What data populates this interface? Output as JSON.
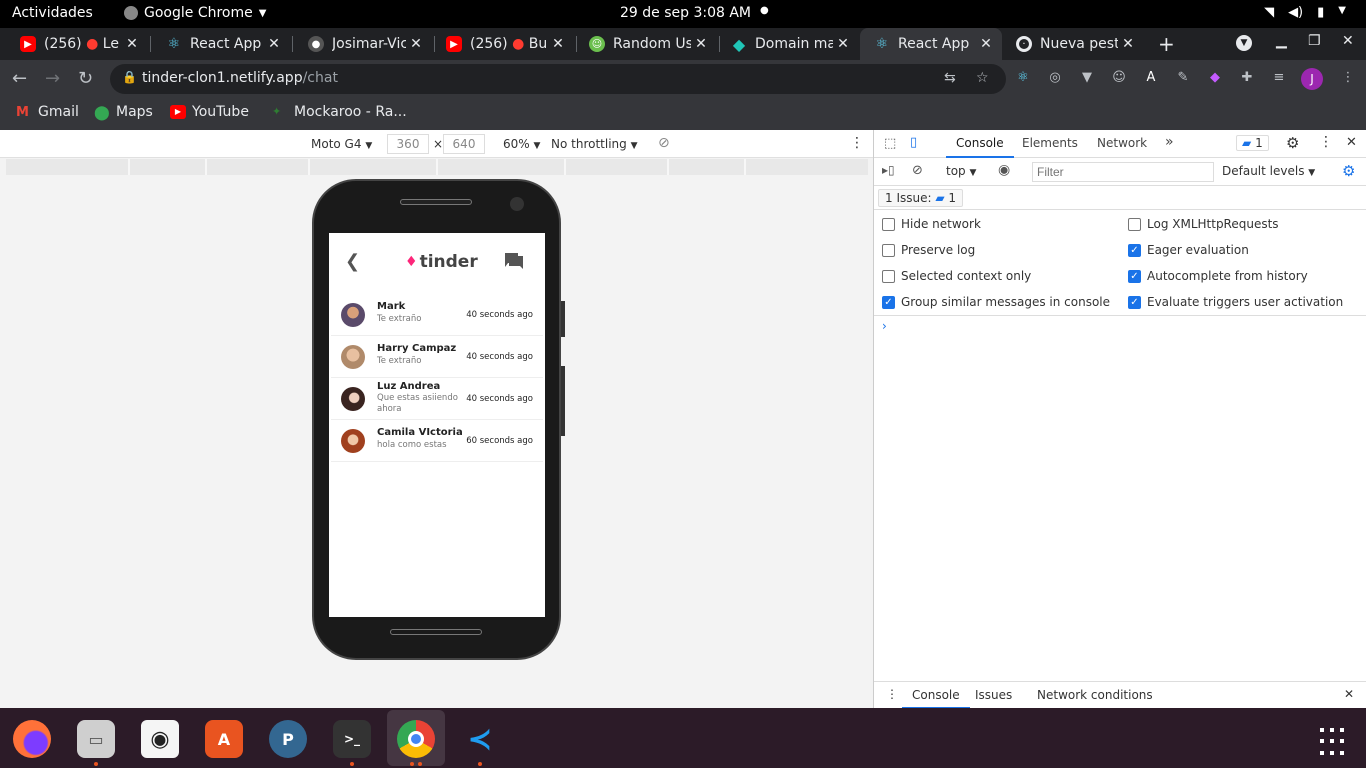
{
  "topbar": {
    "activities": "Actividades",
    "app": "Google Chrome",
    "clock": "29 de sep  3:08 AM"
  },
  "tabs": [
    {
      "title": "(256)",
      "extra": "Le",
      "favicon": "youtube-icon",
      "color": "#ff0000"
    },
    {
      "title": "React App",
      "favicon": "react-icon",
      "color": "#61dafb"
    },
    {
      "title": "Josimar-Vic",
      "favicon": "github-icon",
      "color": "#333333"
    },
    {
      "title": "(256)",
      "extra": "Bu",
      "favicon": "youtube-icon",
      "color": "#ff0000"
    },
    {
      "title": "Random Us",
      "favicon": "randomuser-icon",
      "color": "#6bbf4e"
    },
    {
      "title": "Domain ma",
      "favicon": "netlify-icon",
      "color": "#20c6b7"
    },
    {
      "title": "React App",
      "favicon": "react-icon",
      "color": "#61dafb"
    },
    {
      "title": "Nueva pest",
      "favicon": "chrome-icon",
      "color": "#9aa0a6"
    }
  ],
  "address": {
    "host": "tinder-clon1.netlify.app",
    "path": "/chat"
  },
  "bookmarks": [
    {
      "label": "Gmail",
      "icon": "gmail-icon"
    },
    {
      "label": "Maps",
      "icon": "maps-icon"
    },
    {
      "label": "YouTube",
      "icon": "youtube-icon"
    },
    {
      "label": "Mockaroo - Ra...",
      "icon": "mockaroo-icon"
    }
  ],
  "device_toolbar": {
    "device": "Moto G4",
    "width": "360",
    "height": "640",
    "times": "×",
    "zoom": "60%",
    "throttling": "No throttling"
  },
  "app": {
    "logo": "tinder",
    "chats": [
      {
        "name": "Mark",
        "message": "Te extraño",
        "time": "40 seconds ago",
        "avatar_color": "#8a6a5a"
      },
      {
        "name": "Harry Campaz",
        "message": "Te extraño",
        "time": "40 seconds ago",
        "avatar_color": "#c8a88a"
      },
      {
        "name": "Luz Andrea",
        "message": "Que estas asiiendo ahora",
        "time": "40 seconds ago",
        "avatar_color": "#5a3a32"
      },
      {
        "name": "Camila VIctoria",
        "message": "hola como estas",
        "time": "60 seconds ago",
        "avatar_color": "#b85a3a"
      }
    ]
  },
  "devtools": {
    "tabs": [
      "Console",
      "Elements",
      "Network"
    ],
    "more": "»",
    "issue_count": "1",
    "context": "top",
    "filter_placeholder": "Filter",
    "levels": "Default levels",
    "issues_label": "1 Issue:",
    "issues_count": "1",
    "options_left": [
      {
        "label": "Hide network",
        "checked": false
      },
      {
        "label": "Preserve log",
        "checked": false
      },
      {
        "label": "Selected context only",
        "checked": false
      },
      {
        "label": "Group similar messages in console",
        "checked": true
      }
    ],
    "options_right": [
      {
        "label": "Log XMLHttpRequests",
        "checked": false
      },
      {
        "label": "Eager evaluation",
        "checked": true
      },
      {
        "label": "Autocomplete from history",
        "checked": true
      },
      {
        "label": "Evaluate triggers user activation",
        "checked": true
      }
    ],
    "prompt": "›",
    "drawer_tabs": [
      "Console",
      "Issues",
      "Network conditions"
    ]
  },
  "dock": [
    {
      "name": "firefox-icon",
      "color": "#ff7139",
      "glyph": "🦊",
      "running": false
    },
    {
      "name": "files-icon",
      "color": "#8a8a8a",
      "glyph": "▭",
      "running": true
    },
    {
      "name": "rhythmbox-icon",
      "color": "#f0c419",
      "glyph": "◉",
      "running": false
    },
    {
      "name": "software-icon",
      "color": "#e95420",
      "glyph": "A",
      "running": false
    },
    {
      "name": "pgadmin-icon",
      "color": "#336791",
      "glyph": "🐘",
      "running": false
    },
    {
      "name": "terminal-icon",
      "color": "#333333",
      "glyph": ">_",
      "running": true
    },
    {
      "name": "chrome-icon",
      "color": "#4285f4",
      "glyph": "◎",
      "running": true
    },
    {
      "name": "vscode-icon",
      "color": "#1f7ad1",
      "glyph": "≺",
      "running": true
    }
  ]
}
